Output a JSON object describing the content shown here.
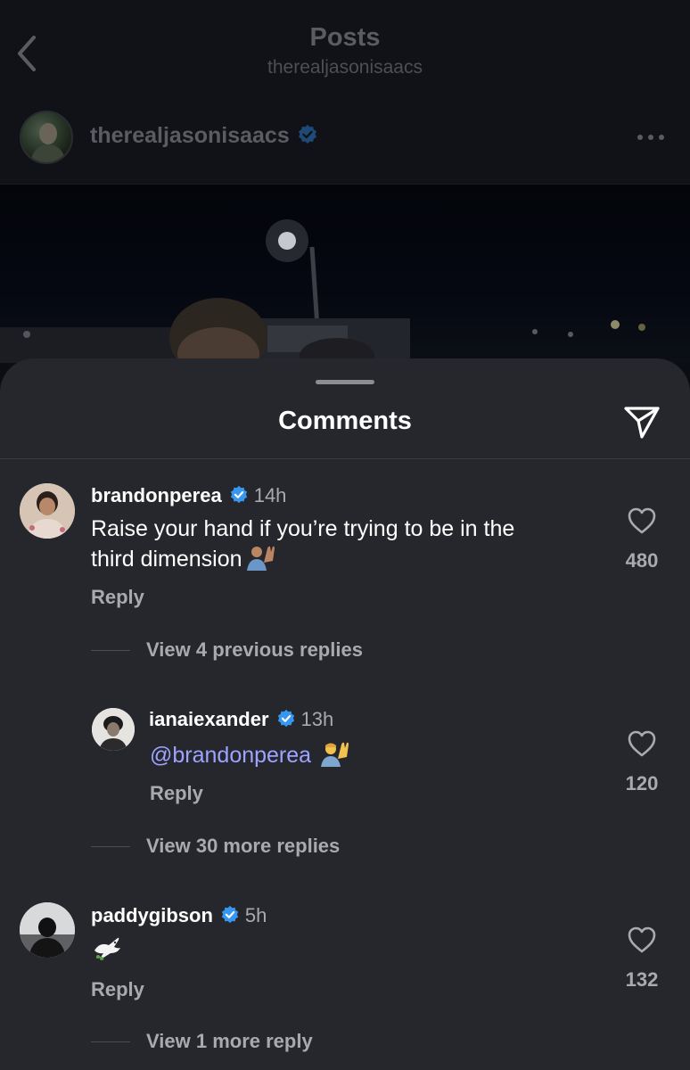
{
  "header": {
    "title": "Posts",
    "subtitle": "therealjasonisaacs"
  },
  "post": {
    "username": "therealjasonisaacs"
  },
  "comments_sheet": {
    "title": "Comments",
    "comments": [
      {
        "username": "brandonperea",
        "time": "14h",
        "text_line1": "Raise your hand if you’re trying to be in the",
        "text_line2": "third dimension",
        "reply_label": "Reply",
        "likes": "480",
        "view_replies": "View 4 previous replies"
      },
      {
        "username": "ianaiexander",
        "time": "13h",
        "mention": "@brandonperea",
        "reply_label": "Reply",
        "likes": "120",
        "view_replies": "View 30 more replies"
      },
      {
        "username": "paddygibson",
        "time": "5h",
        "reply_label": "Reply",
        "likes": "132",
        "view_replies": "View 1 more reply"
      }
    ]
  },
  "colors": {
    "sheet_bg": "#25272c",
    "accent_verified": "#3797f0",
    "mention": "#9ea3ff",
    "muted_text": "#a8aaae"
  },
  "icons": [
    "back-chevron-icon",
    "verified-badge-icon",
    "more-dots-icon",
    "send-icon",
    "heart-icon",
    "raised-hand-emoji",
    "dove-emoji"
  ]
}
